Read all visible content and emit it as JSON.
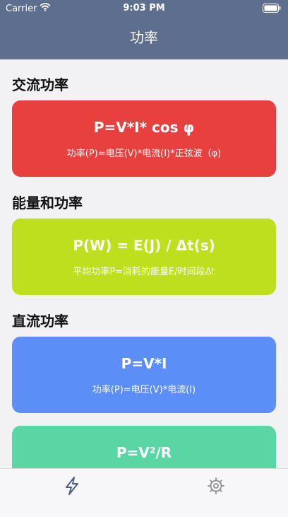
{
  "status_bar": {
    "carrier": "Carrier",
    "time": "9:03 PM"
  },
  "nav": {
    "title": "功率"
  },
  "sections": [
    {
      "title": "交流功率",
      "formula": "P=V*I* cos φ",
      "description": "功率(P)=电压(V)*电流(I)*正弦波（φ)",
      "color": "#e8403f"
    },
    {
      "title": "能量和功率",
      "formula": "P(W) = E(J) / Δt(s)",
      "description": "平均功率P=消耗的能量E/时间段Δt",
      "color": "#bedf1d"
    },
    {
      "title": "直流功率",
      "formula": "P=V*I",
      "description": "功率(P)=电压(V)*电流(I)",
      "color": "#5b8ef6"
    },
    {
      "title": "",
      "formula": "P=V²/R",
      "description": "",
      "color": "#58d6a3"
    }
  ],
  "tab_bar": {
    "items": [
      {
        "icon": "lightning-icon",
        "active": true
      },
      {
        "icon": "gear-icon",
        "active": false
      }
    ]
  }
}
